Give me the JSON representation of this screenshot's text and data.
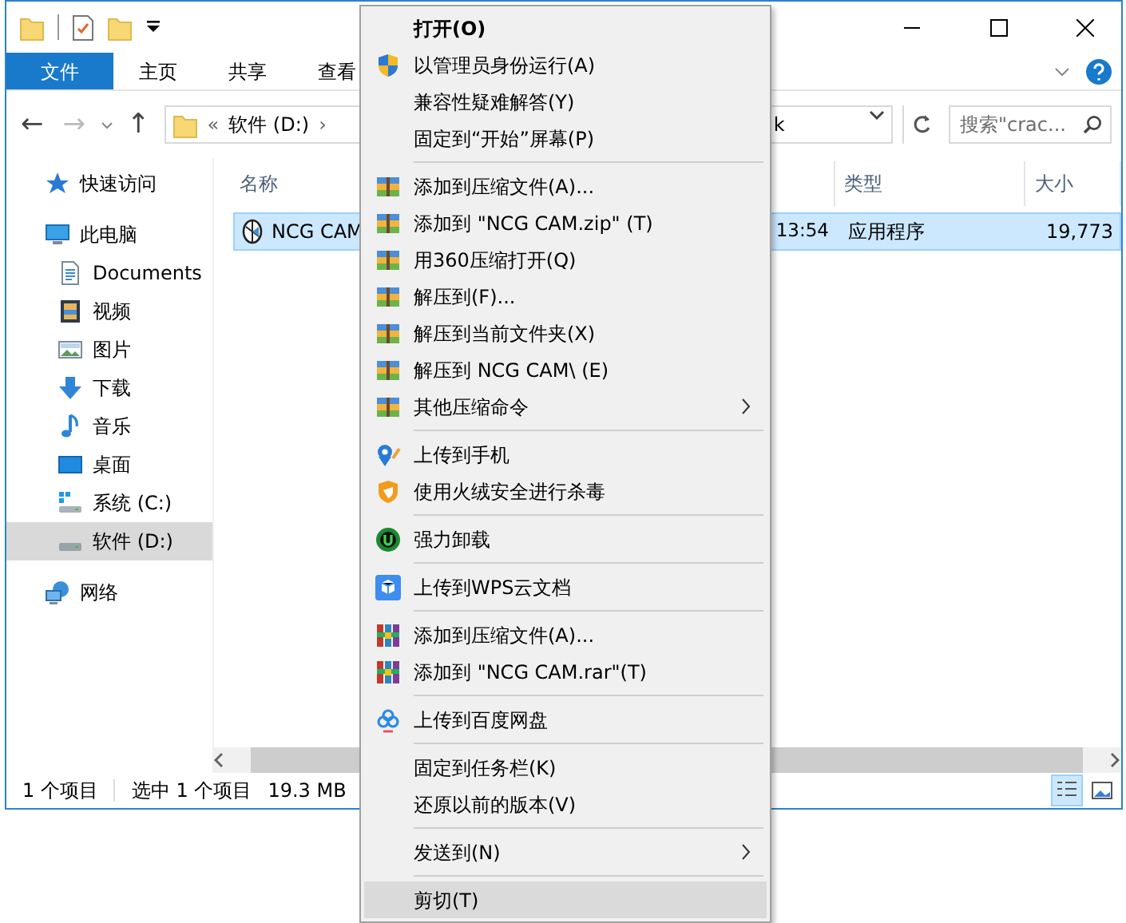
{
  "ribbon_tabs": [
    {
      "label": "文件",
      "kind": "file",
      "selected": false
    },
    {
      "label": "主页",
      "kind": "tab",
      "selected": false
    },
    {
      "label": "共享",
      "kind": "tab",
      "selected": false
    },
    {
      "label": "查看",
      "kind": "tab",
      "selected": false
    }
  ],
  "address_bar": {
    "back": "←",
    "forward": "→",
    "up": "↑",
    "separator": "«",
    "path": "软件 (D:)",
    "path_arrow": "›",
    "tail": "k"
  },
  "search": {
    "placeholder": "搜索\"crac..."
  },
  "nav_pane": [
    {
      "label": "快速访问",
      "selected": false
    },
    {
      "label": "此电脑",
      "selected": false,
      "children": [
        {
          "label": "Documents",
          "selected": false
        },
        {
          "label": "视频",
          "selected": false
        },
        {
          "label": "图片",
          "selected": false
        },
        {
          "label": "下载",
          "selected": false
        },
        {
          "label": "音乐",
          "selected": false
        },
        {
          "label": "桌面",
          "selected": false
        },
        {
          "label": "系统 (C:)",
          "selected": false
        },
        {
          "label": "软件 (D:)",
          "selected": true
        }
      ]
    },
    {
      "label": "网络",
      "selected": false
    }
  ],
  "file_list": {
    "columns": [
      "名称",
      "",
      "类型",
      "大小"
    ],
    "rows": [
      {
        "name": "NCG CAM",
        "date": "13:54",
        "type": "应用程序",
        "size": "19,773",
        "selected": true
      }
    ]
  },
  "status_bar": {
    "item_count": "1 个项目",
    "selection": "选中 1 个项目",
    "selection_size": "19.3 MB",
    "views": [
      {
        "kind": "details",
        "selected": true
      },
      {
        "kind": "large",
        "selected": false
      }
    ]
  },
  "context_menu": [
    [
      {
        "label": "打开(O)",
        "bold": true,
        "submenu": false,
        "selected": false
      },
      {
        "label": "以管理员身份运行(A)",
        "bold": false,
        "submenu": false,
        "selected": false
      },
      {
        "label": "兼容性疑难解答(Y)",
        "bold": false,
        "submenu": false,
        "selected": false
      },
      {
        "label": "固定到“开始”屏幕(P)",
        "bold": false,
        "submenu": false,
        "selected": false
      }
    ],
    [
      {
        "label": "添加到压缩文件(A)...",
        "bold": false,
        "submenu": false,
        "selected": false
      },
      {
        "label": "添加到 \"NCG CAM.zip\" (T)",
        "bold": false,
        "submenu": false,
        "selected": false
      },
      {
        "label": "用360压缩打开(Q)",
        "bold": false,
        "submenu": false,
        "selected": false
      },
      {
        "label": "解压到(F)...",
        "bold": false,
        "submenu": false,
        "selected": false
      },
      {
        "label": "解压到当前文件夹(X)",
        "bold": false,
        "submenu": false,
        "selected": false
      },
      {
        "label": "解压到 NCG CAM\\ (E)",
        "bold": false,
        "submenu": false,
        "selected": false
      },
      {
        "label": "其他压缩命令",
        "bold": false,
        "submenu": true,
        "selected": false
      }
    ],
    [
      {
        "label": "上传到手机",
        "bold": false,
        "submenu": false,
        "selected": false
      },
      {
        "label": "使用火绒安全进行杀毒",
        "bold": false,
        "submenu": false,
        "selected": false
      }
    ],
    [
      {
        "label": "强力卸载",
        "bold": false,
        "submenu": false,
        "selected": false
      }
    ],
    [
      {
        "label": "上传到WPS云文档",
        "bold": false,
        "submenu": false,
        "selected": false
      }
    ],
    [
      {
        "label": "添加到压缩文件(A)...",
        "bold": false,
        "submenu": false,
        "selected": false
      },
      {
        "label": "添加到 \"NCG CAM.rar\"(T)",
        "bold": false,
        "submenu": false,
        "selected": false
      }
    ],
    [
      {
        "label": "上传到百度网盘",
        "bold": false,
        "submenu": false,
        "selected": false
      }
    ],
    [
      {
        "label": "固定到任务栏(K)",
        "bold": false,
        "submenu": false,
        "selected": false
      },
      {
        "label": "还原以前的版本(V)",
        "bold": false,
        "submenu": false,
        "selected": false
      }
    ],
    [
      {
        "label": "发送到(N)",
        "bold": false,
        "submenu": true,
        "selected": false
      }
    ],
    [
      {
        "label": "剪切(T)",
        "bold": false,
        "submenu": false,
        "selected": true
      }
    ]
  ]
}
